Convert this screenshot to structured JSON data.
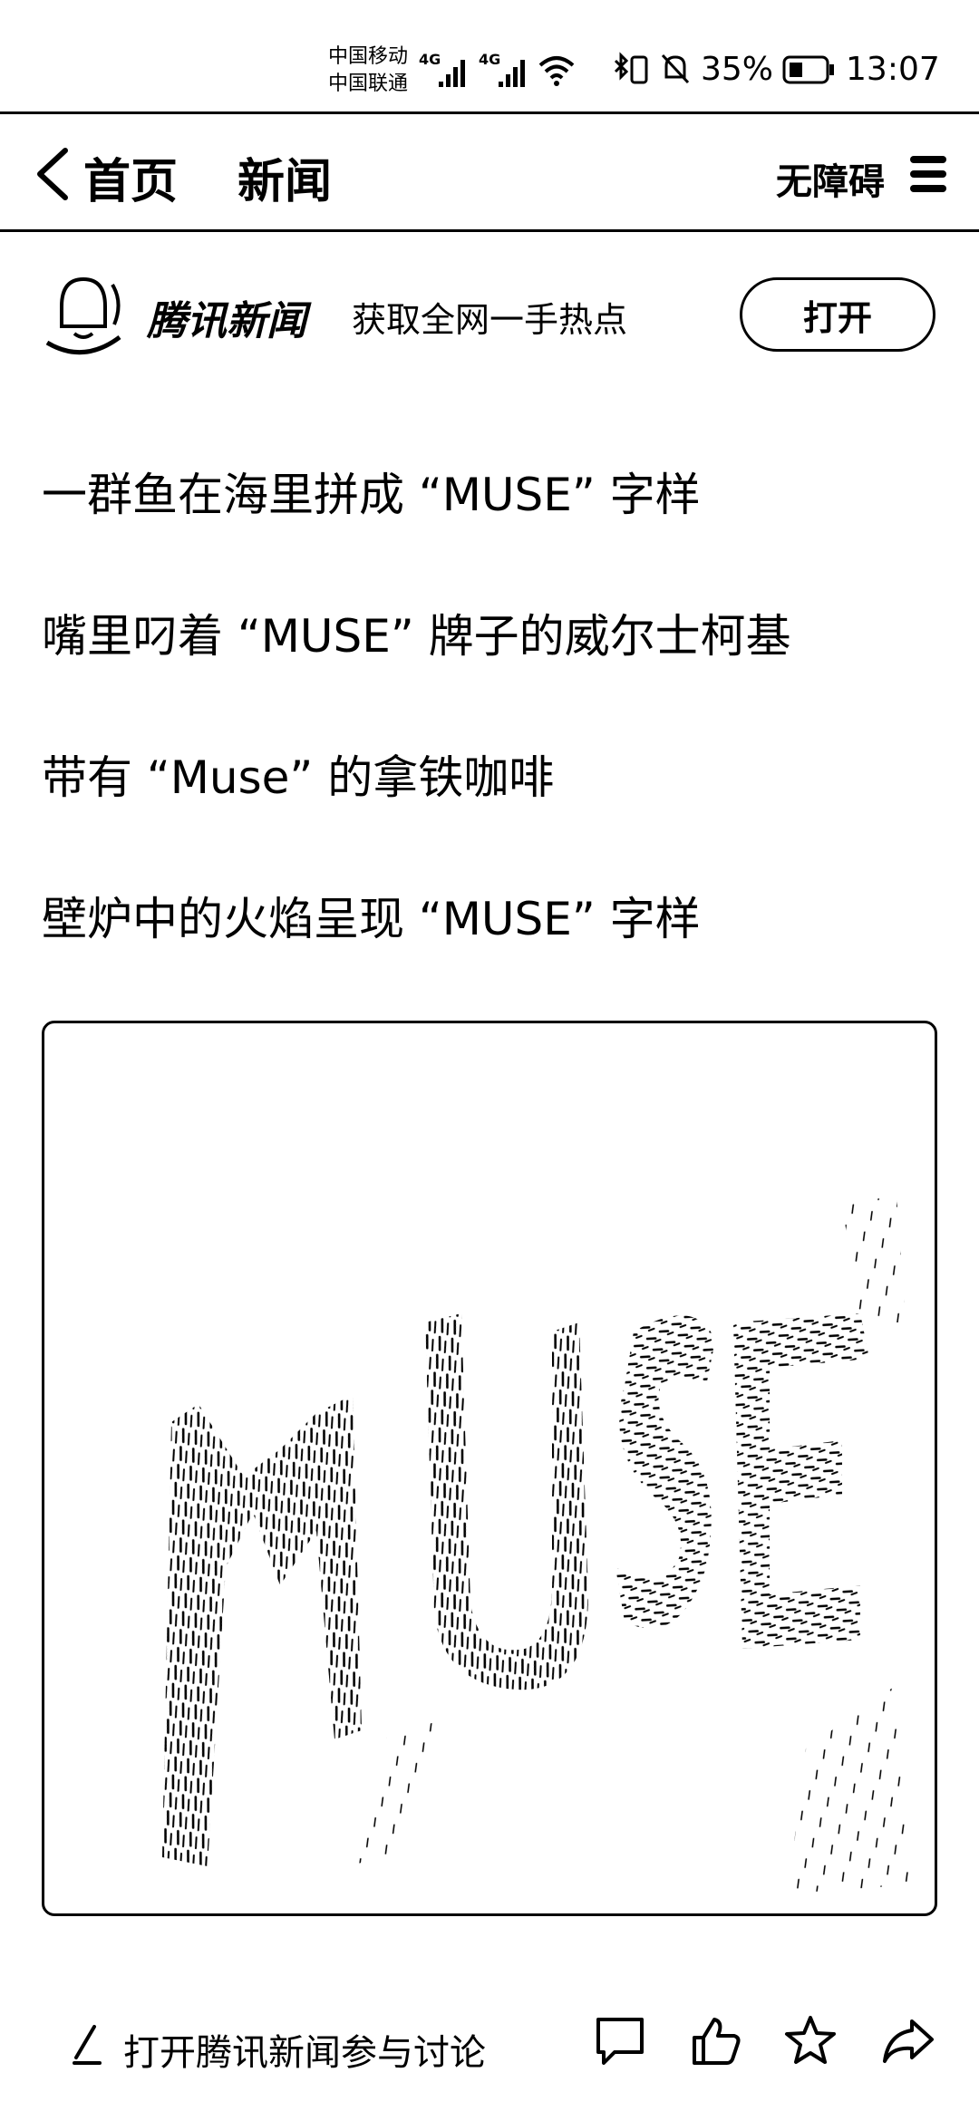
{
  "status_bar": {
    "carrier_1": "中国移动",
    "carrier_2": "中国联通",
    "network_1": "4G",
    "network_2": "4G",
    "battery": "35%",
    "time": "13:07"
  },
  "nav": {
    "back_label": "首页",
    "title": "新闻",
    "accessibility_label": "无障碍"
  },
  "banner": {
    "app_name": "腾讯新闻",
    "slogan": "获取全网一手热点",
    "open_label": "打开"
  },
  "headlines": [
    "一群鱼在海里拼成 “MUSE” 字样",
    "嘴里叼着 “MUSE” 牌子的威尔士柯基",
    "带有 “Muse” 的拿铁咖啡",
    "壁炉中的火焰呈现 “MUSE” 字样"
  ],
  "image": {
    "text": "MUSE",
    "icon": "fish-school-muse-image"
  },
  "bottom_bar": {
    "discuss_label": "打开腾讯新闻参与讨论",
    "icons": [
      "comment-icon",
      "like-icon",
      "star-icon",
      "share-icon"
    ]
  }
}
